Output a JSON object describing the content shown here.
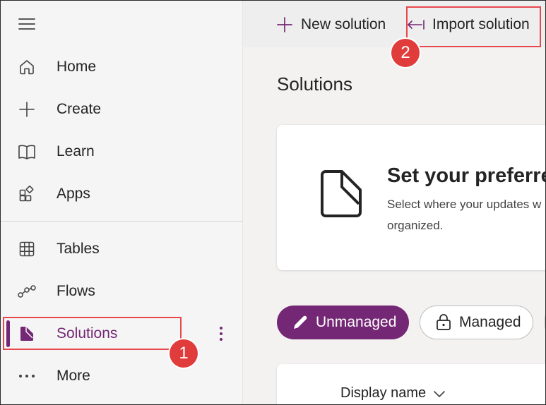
{
  "sidebar": {
    "menu_icon": "hamburger-menu-icon",
    "items": [
      {
        "label": "Home",
        "icon": "home-icon"
      },
      {
        "label": "Create",
        "icon": "plus-icon"
      },
      {
        "label": "Learn",
        "icon": "book-icon"
      },
      {
        "label": "Apps",
        "icon": "apps-icon"
      },
      {
        "label": "Tables",
        "icon": "table-grid-icon"
      },
      {
        "label": "Flows",
        "icon": "flow-icon"
      },
      {
        "label": "Solutions",
        "icon": "solutions-icon",
        "selected": true
      },
      {
        "label": "More",
        "icon": "more-dots-icon"
      }
    ]
  },
  "toolbar": {
    "new_solution": "New solution",
    "import_solution": "Import solution"
  },
  "page": {
    "title": "Solutions"
  },
  "preference_card": {
    "title": "Set your preferre",
    "description_line1": "Select where your updates w",
    "description_line2": "organized."
  },
  "filters": {
    "unmanaged": "Unmanaged",
    "managed": "Managed",
    "active": "Unmanaged"
  },
  "table": {
    "column_display_name": "Display name"
  },
  "annotations": {
    "step1": "1",
    "step2": "2"
  },
  "colors": {
    "accent": "#742774",
    "highlight": "#e8474e",
    "badge": "#e03c3c"
  }
}
